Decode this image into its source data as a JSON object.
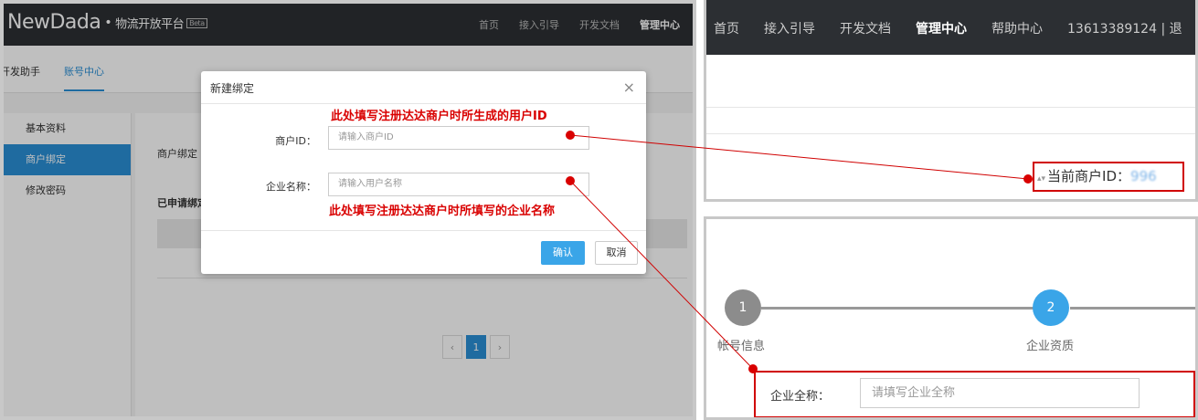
{
  "left_panel": {
    "logo": {
      "brand": "NewDada",
      "dot": "•",
      "subtitle": "物流开放平台",
      "beta": "Beta"
    },
    "topnav": [
      "首页",
      "接入引导",
      "开发文档",
      "管理中心"
    ],
    "subnav": [
      "开发助手",
      "账号中心"
    ],
    "sidebar": [
      "基本资料",
      "商户绑定",
      "修改密码"
    ],
    "main": {
      "label1": "商户绑定",
      "label2": "已申请绑定"
    },
    "pager": {
      "prev": "‹",
      "current": "1",
      "next": "›"
    }
  },
  "modal": {
    "title": "新建绑定",
    "close": "×",
    "note_top": "此处填写注册达达商户时所生成的用户ID",
    "note_bottom": "此处填写注册达达商户时所填写的企业名称",
    "merchant_id_label": "商户ID：",
    "merchant_id_placeholder": "请输入商户ID",
    "company_label": "企业名称：",
    "company_placeholder": "请输入用户名称",
    "confirm": "确认",
    "cancel": "取消"
  },
  "right_top": {
    "nav": [
      "首页",
      "接入引导",
      "开发文档",
      "管理中心",
      "帮助中心"
    ],
    "phone": "13613389124",
    "separator": "|",
    "logout_partial": "退",
    "sort_icon": "▴▾",
    "current_id_label": "当前商户ID：",
    "current_id_value": "996"
  },
  "right_bottom": {
    "step1_num": "1",
    "step1_label": "帐号信息",
    "step2_num": "2",
    "step2_label": "企业资质",
    "company_fullname_label": "企业全称：",
    "company_fullname_placeholder": "请填写企业全称"
  },
  "colors": {
    "accent": "#2a8fd6",
    "annotation_red": "#d90000",
    "topbar_dark": "#2c2f33"
  }
}
